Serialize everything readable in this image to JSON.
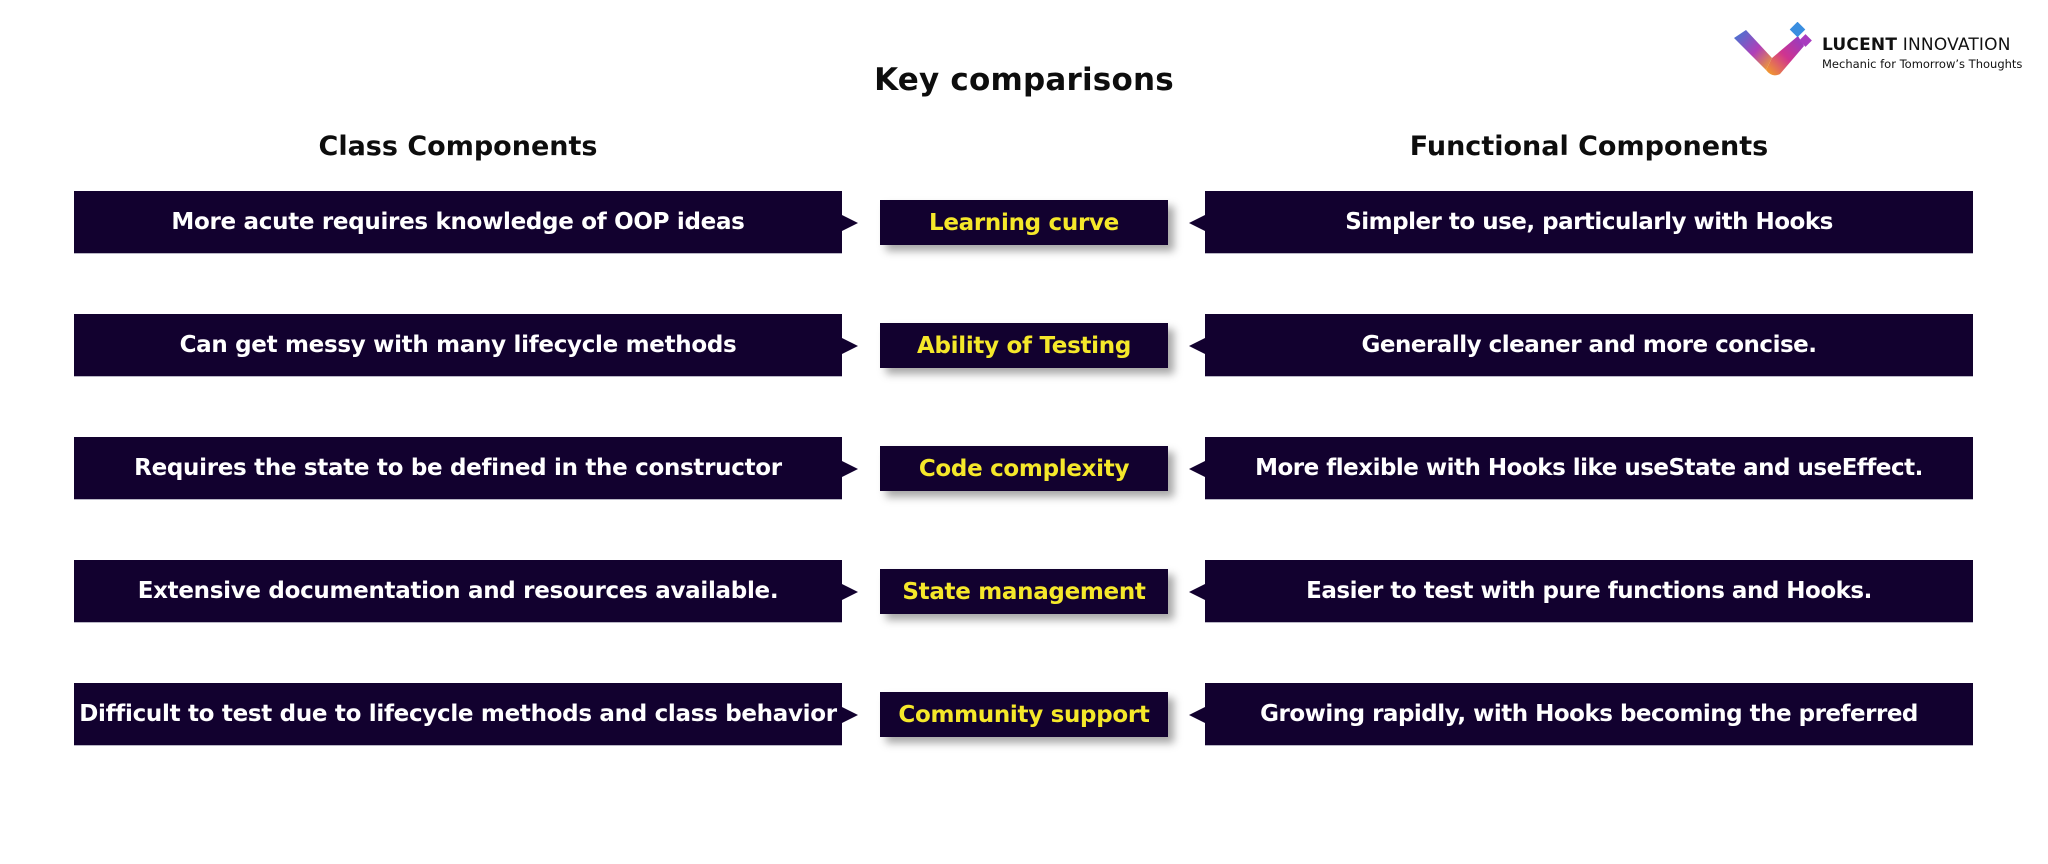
{
  "brand": {
    "name_bold": "LUCENT",
    "name_regular": "INNOVATION",
    "tagline": "Mechanic for Tomorrow’s Thoughts",
    "logo_icon": "lucent-checkmark-logo",
    "gradient_colors": [
      "#3a7bd5",
      "#b03fb8",
      "#f5a623"
    ]
  },
  "title": "Key comparisons",
  "columns": {
    "left_header": "Class Components",
    "right_header": "Functional Components"
  },
  "colors": {
    "box_background": "#12012f",
    "side_text": "#ffffff",
    "center_text": "#f5e82a",
    "heading_text": "#0d0d0d"
  },
  "rows": [
    {
      "criterion": "Learning curve",
      "class_components": "More acute requires knowledge of OOP ideas",
      "functional_components": "Simpler to use, particularly with Hooks"
    },
    {
      "criterion": "Ability of Testing",
      "class_components": "Can get messy with many lifecycle methods",
      "functional_components": "Generally cleaner and more concise."
    },
    {
      "criterion": "Code complexity",
      "class_components": "Requires the state to be defined in the constructor",
      "functional_components": "More flexible with Hooks like useState and useEffect."
    },
    {
      "criterion": "State management",
      "class_components": "Extensive documentation and resources available.",
      "functional_components": "Easier to test with pure functions and Hooks."
    },
    {
      "criterion": "Community support",
      "class_components": "Difficult to test due to lifecycle methods and class behavior",
      "functional_components": "Growing rapidly, with Hooks becoming the preferred"
    }
  ]
}
